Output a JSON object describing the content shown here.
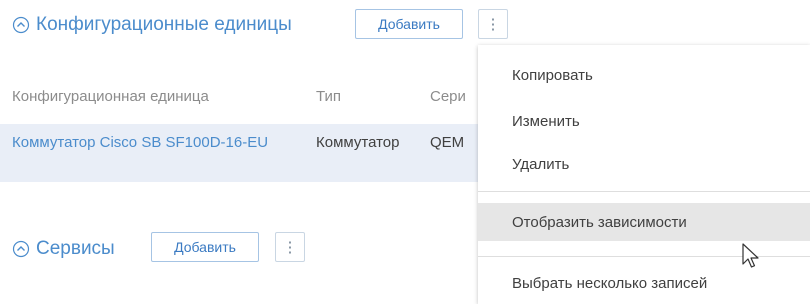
{
  "sections": {
    "config_units": {
      "title": "Конфигурационные единицы",
      "add_label": "Добавить",
      "more_label": "⋮",
      "columns": [
        "Конфигурационная единица",
        "Тип",
        "Сери"
      ],
      "row": {
        "name": "Коммутатор Cisco SB SF100D-16-EU",
        "type": "Коммутатор",
        "serial": "QEM"
      }
    },
    "services": {
      "title": "Сервисы",
      "add_label": "Добавить",
      "more_label": "⋮"
    }
  },
  "context_menu": {
    "items": [
      {
        "label": "Копировать"
      },
      {
        "label": "Изменить"
      },
      {
        "label": "Удалить"
      },
      {
        "label": "Отобразить зависимости"
      },
      {
        "label": "Выбрать несколько записей"
      }
    ]
  },
  "colors": {
    "accent": "#4b8ccc",
    "row_selected": "#e9eef7",
    "menu_hover": "#e6e6e6"
  },
  "icons": {
    "collapse": "chevron-up-circle-icon",
    "more": "vertical-ellipsis-icon",
    "cursor": "mouse-pointer-icon"
  }
}
